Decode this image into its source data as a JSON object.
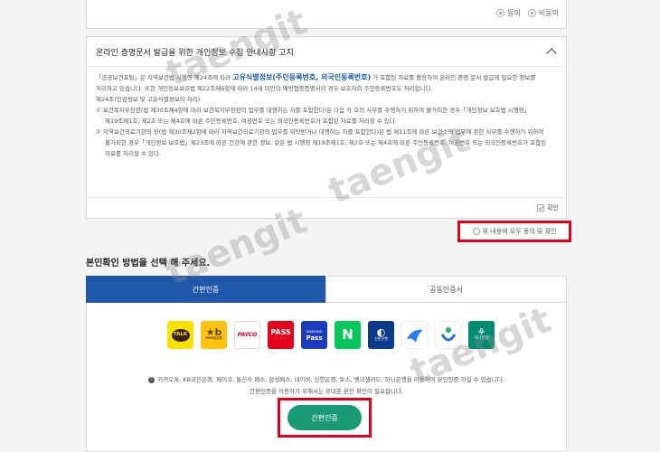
{
  "consent_top": {
    "option_agree": "동의",
    "option_disagree": "비동의"
  },
  "notice": {
    "title": "온라인 증명문서 발급을 위한 개인정보 수집 안내사항 고지",
    "line1_pre": "「공공보건포털」은 지역보건법 시행령 제24조에 따라 ",
    "line1_highlight": "고유식별정보(주민등록번호, 외국인등록번호)",
    "line1_post": "가 포함된 자료를 활용하여 온라인 증명 문서 발급에 필요한 정보를",
    "line2": "처리하고 있습니다. 또한 개인정보보호법 제22조제6항에 따라 14세 미만의 예방접종증명서의 경우 보호자의 주민등록번호도 처리합니다.",
    "line3": "제24조(민감정보 및 고유식별정보의 처리)",
    "line4": "① 보건복지부장관(법 제30조제4항에 따라 보건복지부장관의 업무를 대행하는 자를 포함한다)은 다음 각 호의 사무를 수행하기 위하여 불가피한 경우「개인정보 보호법 시행령」",
    "line5": "제19조제1호, 제2호 또는 제4호에 따른 주민등록번호, 여권번호 또는 외국인등록번호가 포함된 자료를 처리할 수 있다.",
    "line6": "② 지역보건의료기관의 장(법 제30조제2항에 따라 지역보건의료기관의 업무를 위탁받거나 대행하는 자를 포함한다)은 법 제11조에 따른 보건소의 업무에 관한 사무를 수행하기 위하여",
    "line7": "불가피한 경우「개인정보 보호법」제23조에 따른 건강에 관한 정보, 같은 법 시행령 제19조제1호, 제2호 또는 제4호에 따른 주민등록번호, 여권번호 또는 외국인등록번호가 포함된",
    "line8": "자료를 처리할 수 있다.",
    "confirm_label": "확인"
  },
  "agree_all_label": "위 내용에 모두 동의 및 확인",
  "method_title": "본인확인 방법을 선택 해 주세요.",
  "tabs": [
    {
      "label": "간편인증",
      "active": true
    },
    {
      "label": "공동인증서",
      "active": false
    }
  ],
  "providers": [
    {
      "name": "kakao-icon",
      "text": "TALK"
    },
    {
      "name": "kb-icon",
      "text": "KB국민은행"
    },
    {
      "name": "payco-icon",
      "text": "PAYCO"
    },
    {
      "name": "pass-icon",
      "text": "PASS"
    },
    {
      "name": "samsung-pass-icon",
      "text": "Pass"
    },
    {
      "name": "naver-icon",
      "text": "N"
    },
    {
      "name": "shinhan-icon",
      "text": "신한은행"
    },
    {
      "name": "toss-icon",
      "text": ""
    },
    {
      "name": "bank-icon",
      "text": ""
    },
    {
      "name": "hana-icon",
      "text": "하나은행"
    }
  ],
  "info_line1": "카카오톡, KB국민은행, 페이코, 통신사 패스, 삼성패스, 네이버, 신한은행, 토스, 뱅크샐러드, 하나은행을 이용하여 본인인증 하실 수 있습니다.",
  "info_line2": "간편인증을 이용하기 위해서는 휴대폰 본인 확인이 필요합니다.",
  "auth_button_label": "간편인증",
  "watermark": "taengit",
  "colors": {
    "primary_tab": "#1f58a8",
    "auth_button": "#1a9a73",
    "highlight_box": "#e3001b"
  }
}
